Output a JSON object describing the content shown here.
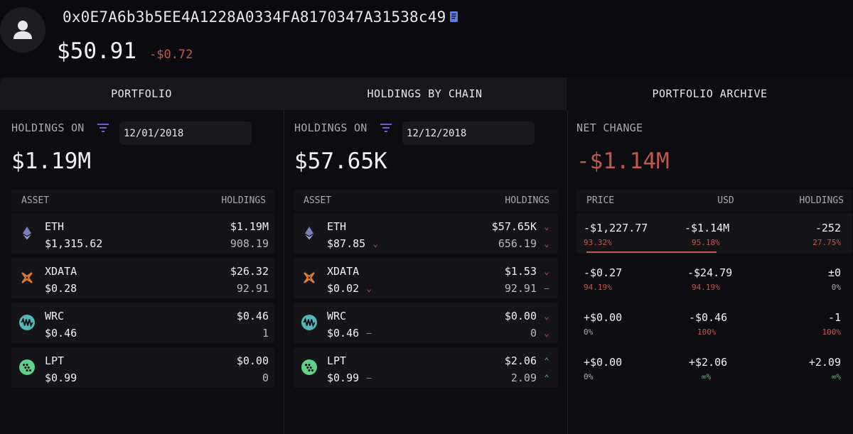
{
  "header": {
    "address": "0x0E7A6b3b5EE4A1228A0334FA8170347A31538c49",
    "balance": "$50.91",
    "balance_change": "-$0.72"
  },
  "tabs": [
    {
      "label": "PORTFOLIO"
    },
    {
      "label": "HOLDINGS BY CHAIN"
    },
    {
      "label": "PORTFOLIO ARCHIVE"
    }
  ],
  "panels": [
    {
      "label": "HOLDINGS ON",
      "date": "12/01/2018",
      "total": "$1.19M",
      "col_asset": "ASSET",
      "col_holdings": "HOLDINGS",
      "rows": [
        {
          "name": "ETH",
          "price": "$1,315.62",
          "usd": "$1.19M",
          "amount": "908.19"
        },
        {
          "name": "XDATA",
          "price": "$0.28",
          "usd": "$26.32",
          "amount": "92.91"
        },
        {
          "name": "WRC",
          "price": "$0.46",
          "usd": "$0.46",
          "amount": "1"
        },
        {
          "name": "LPT",
          "price": "$0.99",
          "usd": "$0.00",
          "amount": "0"
        }
      ]
    },
    {
      "label": "HOLDINGS ON",
      "date": "12/12/2018",
      "total": "$57.65K",
      "col_asset": "ASSET",
      "col_holdings": "HOLDINGS",
      "rows": [
        {
          "name": "ETH",
          "price": "$87.85",
          "price_dir": "down",
          "usd": "$57.65K",
          "usd_dir": "down",
          "amount": "656.19",
          "amount_dir": "down"
        },
        {
          "name": "XDATA",
          "price": "$0.02",
          "price_dir": "down",
          "usd": "$1.53",
          "usd_dir": "down",
          "amount": "92.91",
          "amount_dir": "flat"
        },
        {
          "name": "WRC",
          "price": "$0.46",
          "price_dir": "flat",
          "usd": "$0.00",
          "usd_dir": "down",
          "amount": "0",
          "amount_dir": "down"
        },
        {
          "name": "LPT",
          "price": "$0.99",
          "price_dir": "flat",
          "usd": "$2.06",
          "usd_dir": "up",
          "amount": "2.09",
          "amount_dir": "up"
        }
      ]
    }
  ],
  "net_change": {
    "label": "NET CHANGE",
    "total": "-$1.14M",
    "col_price": "PRICE",
    "col_usd": "USD",
    "col_holdings": "HOLDINGS",
    "rows": [
      {
        "price": "-$1,227.77",
        "price_pct": "93.32%",
        "price_pct_color": "red",
        "usd": "-$1.14M",
        "usd_pct": "95.18%",
        "usd_pct_color": "red",
        "holdings": "-252",
        "holdings_pct": "27.75%",
        "holdings_pct_color": "red"
      },
      {
        "price": "-$0.27",
        "price_pct": "94.19%",
        "price_pct_color": "red",
        "usd": "-$24.79",
        "usd_pct": "94.19%",
        "usd_pct_color": "red",
        "holdings": "±0",
        "holdings_pct": "0%",
        "holdings_pct_color": "gray"
      },
      {
        "price": "+$0.00",
        "price_pct": "0%",
        "price_pct_color": "gray",
        "usd": "-$0.46",
        "usd_pct": "100%",
        "usd_pct_color": "red",
        "holdings": "-1",
        "holdings_pct": "100%",
        "holdings_pct_color": "red"
      },
      {
        "price": "+$0.00",
        "price_pct": "0%",
        "price_pct_color": "gray",
        "usd": "+$2.06",
        "usd_pct": "∞%",
        "usd_pct_color": "green",
        "holdings": "+2.09",
        "holdings_pct": "∞%",
        "holdings_pct_color": "green"
      }
    ]
  },
  "colors": {
    "negative": "#c0594b",
    "positive": "#5fb36a",
    "accent": "#6b5fd6"
  },
  "icons": {
    "ETH": "ethereum-icon",
    "XDATA": "xdata-icon",
    "WRC": "wrc-icon",
    "LPT": "lpt-icon"
  }
}
